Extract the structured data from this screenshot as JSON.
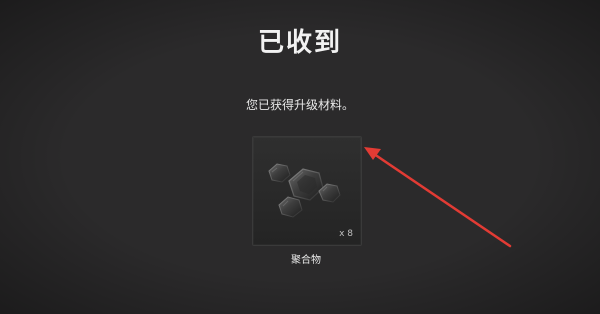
{
  "dialog": {
    "title": "已收到",
    "message": "您已获得升级材料。"
  },
  "reward": {
    "item_name": "聚合物",
    "quantity_label": "x 8",
    "icon": "hexagon-materials-icon"
  },
  "annotation": {
    "icon": "red-arrow-icon",
    "color": "#e23b34"
  }
}
